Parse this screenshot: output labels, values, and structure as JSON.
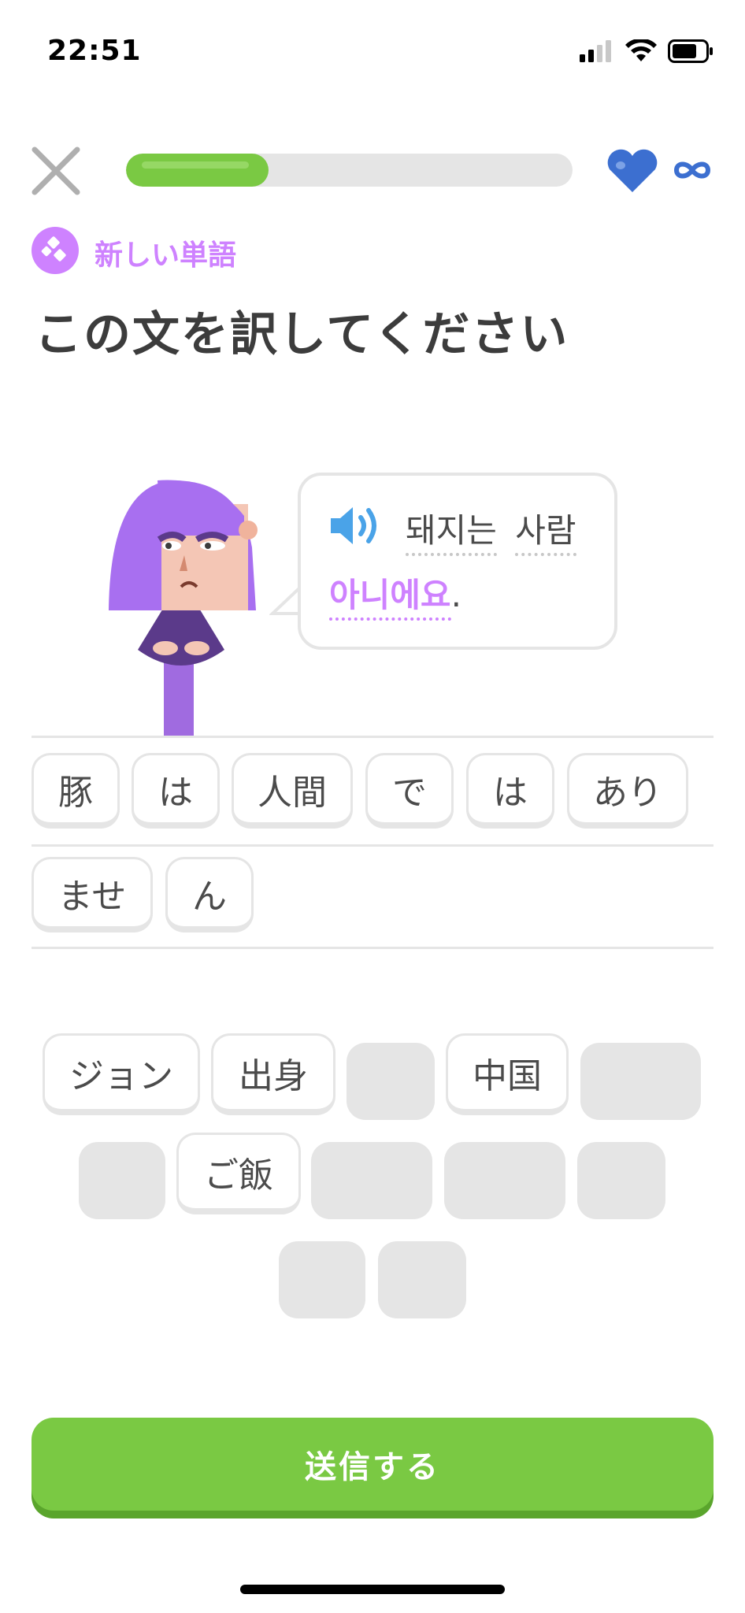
{
  "status_bar": {
    "time": "22:51"
  },
  "header": {
    "progress_fraction": 0.32,
    "hearts": "∞"
  },
  "tag": {
    "label": "新しい単語"
  },
  "prompt": {
    "title": "この文を訳してください"
  },
  "bubble": {
    "words": [
      "돼지는",
      "사람",
      "아니에요"
    ],
    "punctuation": "."
  },
  "answer_tiles": [
    "豚",
    "は",
    "人間",
    "で",
    "は",
    "あり",
    "ませ",
    "ん"
  ],
  "bank_tiles": [
    "ジョン",
    "出身",
    "中国",
    "ご飯"
  ],
  "check_button": {
    "label": "送信する"
  },
  "colors": {
    "accent_green": "#7ac943",
    "accent_purple": "#ce82ff",
    "heart_blue": "#3c6fd0",
    "speaker_blue": "#4aa3e8"
  },
  "icons": {
    "close": "close-icon",
    "heart": "heart-icon",
    "infinity": "infinity-icon",
    "speaker": "speaker-icon",
    "new_word": "new-word-icon"
  }
}
